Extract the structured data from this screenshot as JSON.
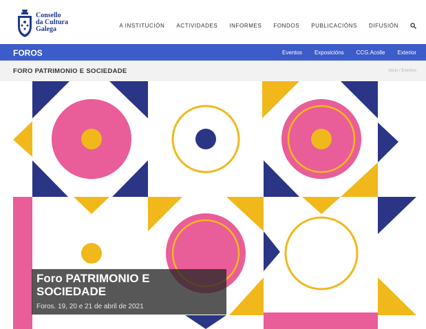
{
  "brand": {
    "logo_lines": [
      "Consello",
      "da Cultura",
      "Galega"
    ]
  },
  "nav": {
    "items": [
      "A INSTITUCIÓN",
      "ACTIVIDADES",
      "INFORMES",
      "FONDOS",
      "PUBLICACIÓNS",
      "DIFUSIÓN"
    ],
    "search_icon": "search-icon"
  },
  "section_bar": {
    "title": "FOROS",
    "links": [
      "Eventos",
      "Exposicións",
      "CCG.Acolle",
      "Exterior"
    ]
  },
  "breadcrumb": {
    "page_title": "FORO PATRIMONIO E SOCIEDADE",
    "trail": "Inicio / Eventos"
  },
  "hero": {
    "title": "Foro PATRIMONIO E SOCIEDADE",
    "meta": "Foros. 19, 20 e 21 de abril de 2021"
  },
  "colors": {
    "navy": "#2a3585",
    "pink": "#e95d98",
    "yellow": "#f1b81c",
    "bar_blue": "#3b5cc9"
  }
}
